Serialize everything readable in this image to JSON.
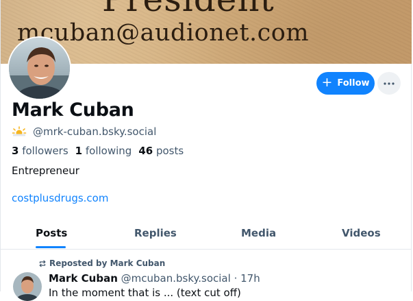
{
  "banner": {
    "line1": "President",
    "line2": "mcuban@audionet.com"
  },
  "profile": {
    "display_name": "Mark Cuban",
    "handle": "@mrk-cuban.bsky.social",
    "stats": {
      "followers_count": "3",
      "followers_label": "followers",
      "following_count": "1",
      "following_label": "following",
      "posts_count": "46",
      "posts_label": "posts"
    },
    "bio": "Entrepreneur",
    "link": "costplusdrugs.com"
  },
  "actions": {
    "follow_label": "Follow"
  },
  "tabs": [
    {
      "label": "Posts",
      "active": true
    },
    {
      "label": "Replies",
      "active": false
    },
    {
      "label": "Media",
      "active": false
    },
    {
      "label": "Videos",
      "active": false
    }
  ],
  "feed": {
    "repost_label": "Reposted by Mark Cuban",
    "post": {
      "author": "Mark Cuban",
      "handle": "@mcuban.bsky.social",
      "separator": "·",
      "time": "17h",
      "text": "In the moment that is ... (text cut off)"
    }
  },
  "colors": {
    "accent": "#1083fe",
    "text_primary": "#0b0f14",
    "text_secondary": "#42576c",
    "divider": "#e3e7ec"
  },
  "icons": [
    "sun-badge-icon",
    "plus-icon",
    "ellipsis-icon",
    "repost-icon"
  ]
}
